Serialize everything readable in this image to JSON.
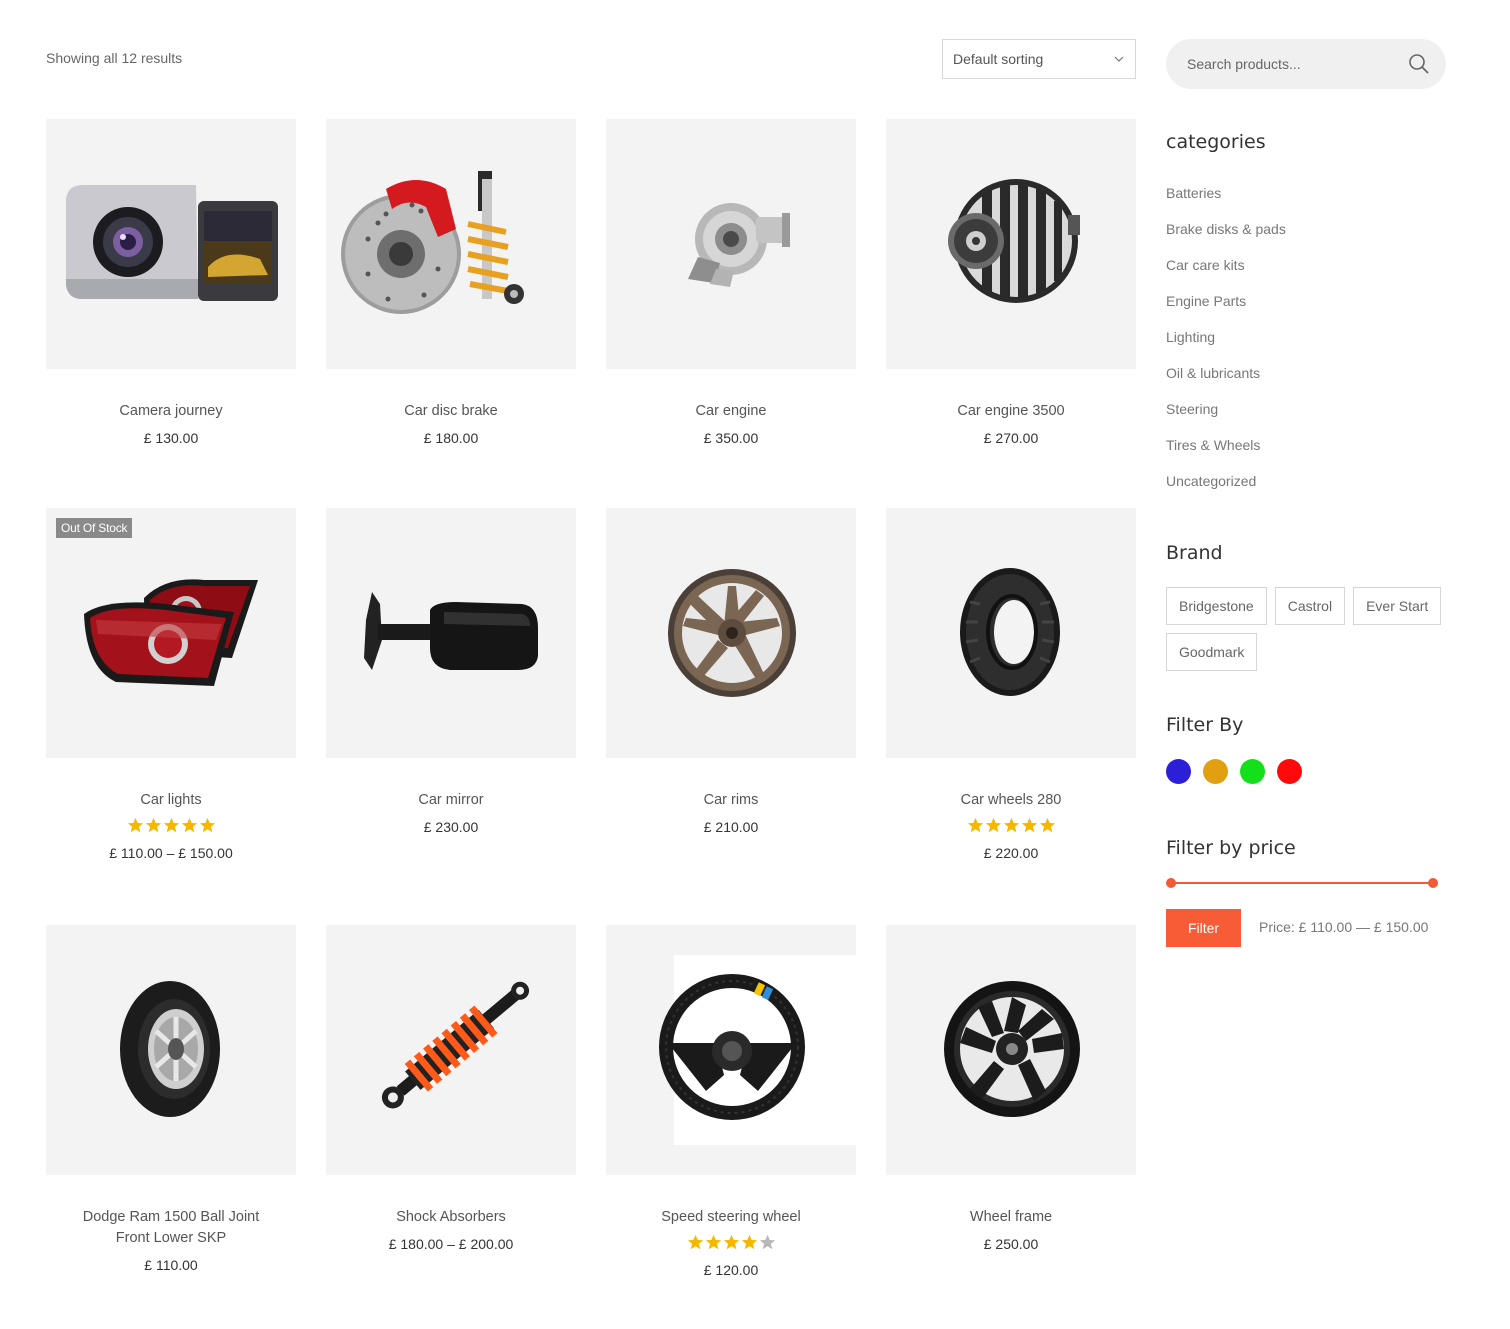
{
  "toolbar": {
    "results_text": "Showing all 12 results",
    "sort_selected": "Default sorting"
  },
  "products": [
    {
      "name": "Camera journey",
      "price": "£ 130.00",
      "rating": null,
      "badge": null,
      "icon": "dashcam-image"
    },
    {
      "name": "Car disc brake",
      "price": "£ 180.00",
      "rating": null,
      "badge": null,
      "icon": "disc-brake-image"
    },
    {
      "name": "Car engine",
      "price": "£ 350.00",
      "rating": null,
      "badge": null,
      "icon": "turbocharger-image"
    },
    {
      "name": "Car engine 3500",
      "price": "£ 270.00",
      "rating": null,
      "badge": null,
      "icon": "alternator-image"
    },
    {
      "name": "Car lights",
      "price": "£ 110.00 – £ 150.00",
      "rating": 5,
      "badge": "Out Of Stock",
      "icon": "tail-lights-image"
    },
    {
      "name": "Car mirror",
      "price": "£ 230.00",
      "rating": null,
      "badge": null,
      "icon": "side-mirror-image"
    },
    {
      "name": "Car rims",
      "price": "£ 210.00",
      "rating": null,
      "badge": null,
      "icon": "bronze-rim-image"
    },
    {
      "name": "Car wheels 280",
      "price": "£ 220.00",
      "rating": 5,
      "badge": null,
      "icon": "tire-image"
    },
    {
      "name": "Dodge Ram 1500 Ball Joint Front Lower SKP",
      "price": "£ 110.00",
      "rating": null,
      "badge": null,
      "icon": "wheel-tire-image"
    },
    {
      "name": "Shock Absorbers",
      "price": "£ 180.00 – £ 200.00",
      "rating": null,
      "badge": null,
      "icon": "shock-absorber-image"
    },
    {
      "name": "Speed steering wheel",
      "price": "£ 120.00",
      "rating": 4,
      "badge": null,
      "icon": "steering-wheel-image"
    },
    {
      "name": "Wheel frame",
      "price": "£ 250.00",
      "rating": null,
      "badge": null,
      "icon": "black-rim-image"
    }
  ],
  "sidebar": {
    "search_placeholder": "Search products...",
    "categories_title": "categories",
    "categories": [
      "Batteries",
      "Brake disks & pads",
      "Car care kits",
      "Engine Parts",
      "Lighting",
      "Oil & lubricants",
      "Steering",
      "Tires & Wheels",
      "Uncategorized"
    ],
    "brand_title": "Brand",
    "brands": [
      "Bridgestone",
      "Castrol",
      "Ever Start",
      "Goodmark"
    ],
    "filter_by_title": "Filter By",
    "color_swatches": [
      "#2b1fd8",
      "#e0a011",
      "#13e01a",
      "#ff0a0a"
    ],
    "price_title": "Filter by price",
    "filter_button": "Filter",
    "price_range": "Price: £ 110.00 — £ 150.00"
  },
  "colors": {
    "accent": "#f75c36",
    "star": "#f5b800",
    "star_empty": "#b8b8b8"
  }
}
